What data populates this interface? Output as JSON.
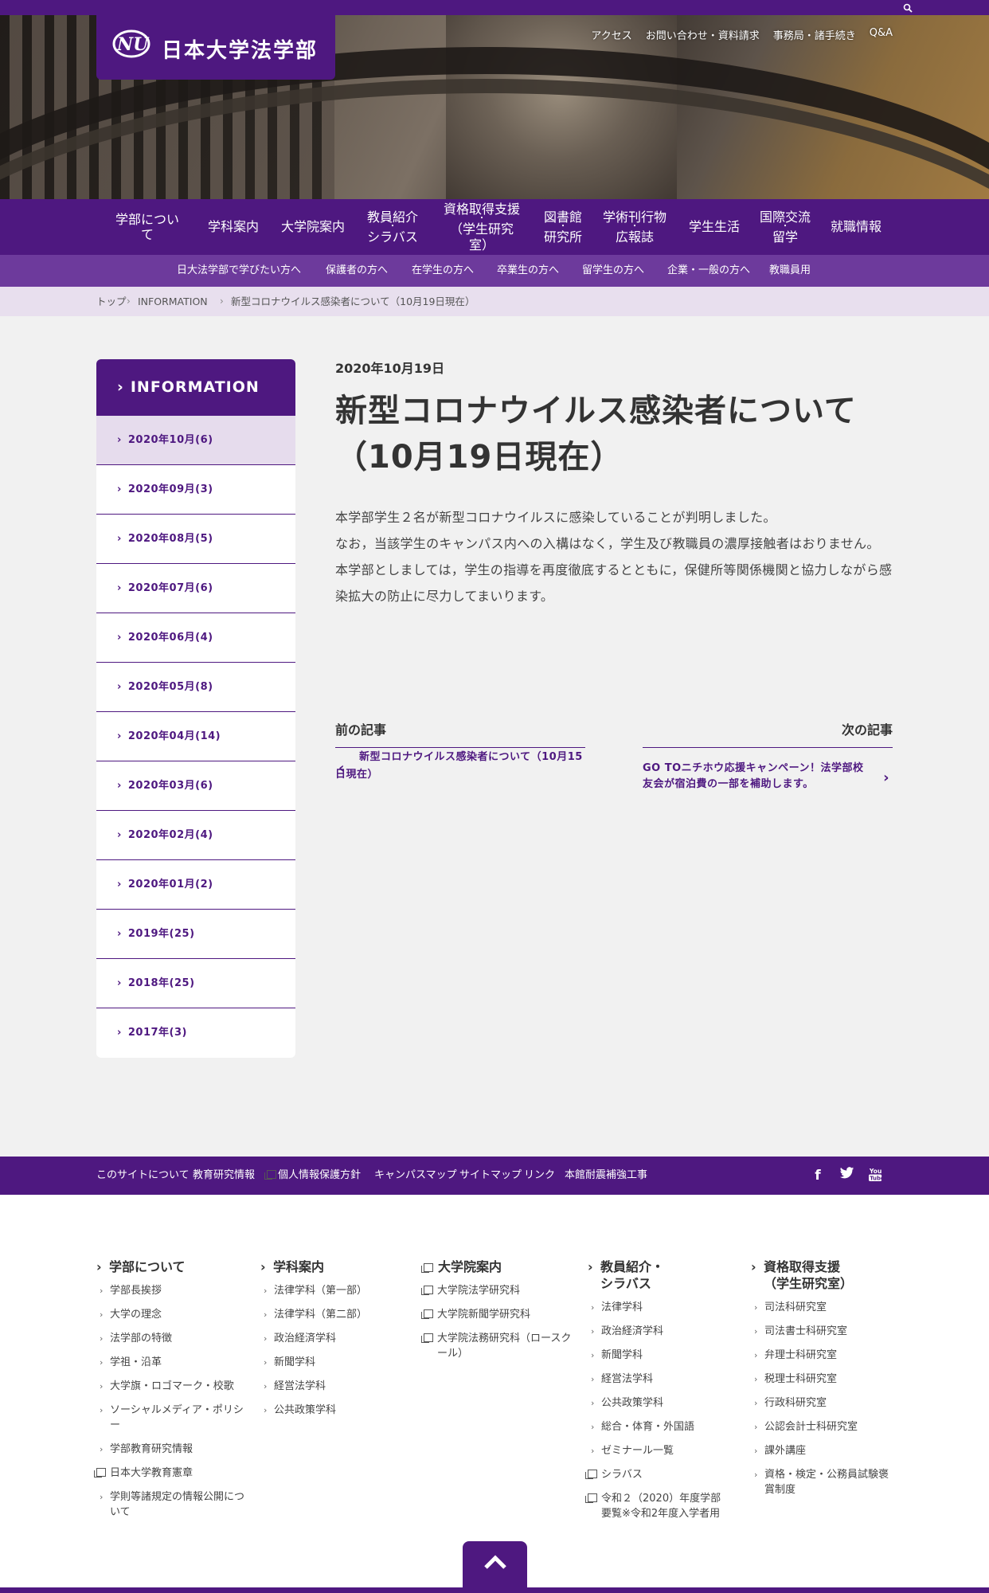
{
  "colors": {
    "brand": "#4e1880",
    "subnav": "#6d3a9c",
    "breadcrumb_bg": "#e8dfee"
  },
  "logo": {
    "text": "日本大学法学部"
  },
  "utility_nav": [
    "アクセス",
    "お問い合わせ・資料請求",
    "事務局・諸手続き",
    "Q&A"
  ],
  "main_nav": [
    {
      "line1": "学部について",
      "line2": ""
    },
    {
      "line1": "学科案内",
      "line2": ""
    },
    {
      "line1": "大学院案内",
      "line2": ""
    },
    {
      "line1": "教員紹介",
      "line2": "シラバス"
    },
    {
      "line1": "資格取得支援",
      "line2": "（学生研究室）"
    },
    {
      "line1": "図書館",
      "line2": "研究所"
    },
    {
      "line1": "学術刊行物",
      "line2": "広報誌"
    },
    {
      "line1": "学生生活",
      "line2": ""
    },
    {
      "line1": "国際交流",
      "line2": "留学"
    },
    {
      "line1": "就職情報",
      "line2": ""
    }
  ],
  "sub_nav": [
    "日大法学部で学びたい方へ",
    "保護者の方へ",
    "在学生の方へ",
    "卒業生の方へ",
    "留学生の方へ",
    "企業・一般の方へ",
    "教職員用"
  ],
  "breadcrumb": [
    "トップ",
    "INFORMATION",
    "新型コロナウイルス感染者について（10月19日現在）"
  ],
  "sidebar": {
    "heading": "INFORMATION",
    "items": [
      "2020年10月(6)",
      "2020年09月(3)",
      "2020年08月(5)",
      "2020年07月(6)",
      "2020年06月(4)",
      "2020年05月(8)",
      "2020年04月(14)",
      "2020年03月(6)",
      "2020年02月(4)",
      "2020年01月(2)",
      "2019年(25)",
      "2018年(25)",
      "2017年(3)"
    ]
  },
  "article": {
    "date": "2020年10月19日",
    "title": "新型コロナウイルス感染者について（10月19日現在）",
    "body": [
      "本学部学生２名が新型コロナウイルスに感染していることが判明しました。",
      "なお，当該学生のキャンパス内への入構はなく，学生及び教職員の濃厚接触者はおりません。",
      "本学部としましては，学生の指導を再度徹底するとともに，保健所等関係機関と協力しながら感染拡大の防止に尽力してまいります。"
    ]
  },
  "pager": {
    "prev_label": "前の記事",
    "prev_title": "新型コロナウイルス感染者について（10月15日現在）",
    "next_label": "次の記事",
    "next_title": "GO TOニチホウ応援キャンペーン！法学部校友会が宿泊費の一部を補助します。"
  },
  "footer_nav": [
    "このサイトについて",
    "教育研究情報",
    "個人情報保護方針",
    "キャンパスマップ",
    "サイトマップ",
    "リンク",
    "本館耐震補強工事"
  ],
  "sitemap": [
    {
      "heading": "学部について",
      "links": [
        "学部長挨拶",
        "大学の理念",
        "法学部の特徴",
        "学祖・沿革",
        "大学旗・ロゴマーク・校歌",
        "ソーシャルメディア・ポリシー",
        "学部教育研究情報",
        "日本大学教育憲章",
        "学則等諸規定の情報公開について"
      ]
    },
    {
      "heading": "学科案内",
      "links": [
        "法律学科（第一部）",
        "法律学科（第二部）",
        "政治経済学科",
        "新聞学科",
        "経営法学科",
        "公共政策学科"
      ]
    },
    {
      "heading": "大学院案内",
      "links": [
        "大学院法学研究科",
        "大学院新聞学研究科",
        "大学院法務研究科（ロースクール）"
      ]
    },
    {
      "heading": "教員紹介・シラバス",
      "links": [
        "法律学科",
        "政治経済学科",
        "新聞学科",
        "経営法学科",
        "公共政策学科",
        "総合・体育・外国語",
        "ゼミナール一覧",
        "シラバス",
        "令和２（2020）年度学部要覧※令和2年度入学者用"
      ]
    },
    {
      "heading": "資格取得支援（学生研究室）",
      "links": [
        "司法科研究室",
        "司法書士科研究室",
        "弁理士科研究室",
        "税理士科研究室",
        "行政科研究室",
        "公認会計士科研究室",
        "課外講座",
        "資格・検定・公務員試験褒賞制度"
      ]
    }
  ]
}
